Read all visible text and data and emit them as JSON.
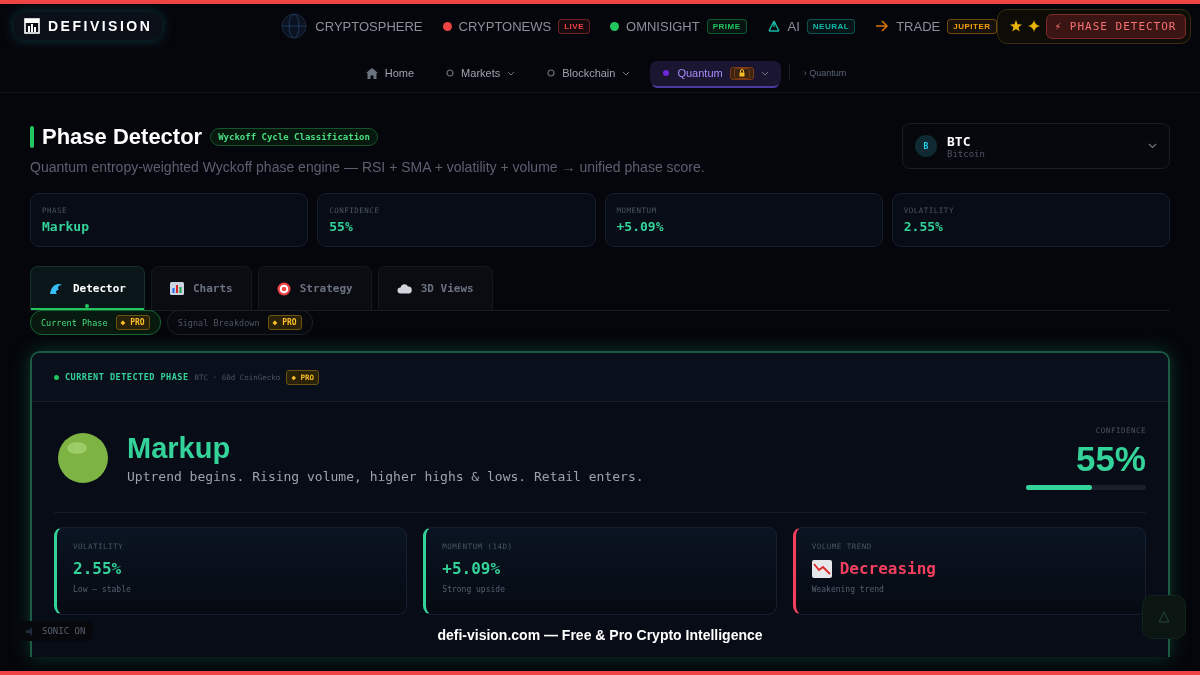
{
  "brand": {
    "name": "DEFIVISION"
  },
  "top_nav": [
    {
      "label": "CRYPTOSPHERE",
      "kind": "globe"
    },
    {
      "label": "CRYPTONEWS",
      "kind": "dot",
      "badge": "LIVE",
      "color": "#ef4444"
    },
    {
      "label": "OMNISIGHT",
      "kind": "dot",
      "badge": "PRIME",
      "color": "#22c55e"
    },
    {
      "label": "AI",
      "kind": "nodes",
      "badge": "NEURAL",
      "color": "#14b8a6"
    },
    {
      "label": "TRADE",
      "kind": "arrow",
      "badge": "JUPITER",
      "color": "#f59e0b"
    }
  ],
  "upgrade": {
    "label": "⚡ PHASE DETECTOR"
  },
  "sub_nav": [
    {
      "label": "Home",
      "kind": "home",
      "selected": false,
      "dropdown": false,
      "locked": false
    },
    {
      "label": "Markets",
      "kind": "ring",
      "selected": false,
      "dropdown": true,
      "locked": false
    },
    {
      "label": "Blockchain",
      "kind": "ring",
      "selected": false,
      "dropdown": true,
      "locked": false
    },
    {
      "label": "Quantum",
      "kind": "dot",
      "selected": true,
      "dropdown": true,
      "locked": true
    }
  ],
  "breadcrumb": "› Quantum",
  "header": {
    "title": "Phase Detector",
    "tag": "Wyckoff Cycle Classification",
    "subtitle": "Quantum entropy-weighted Wyckoff phase engine — RSI + SMA + volatility + volume → unified phase score."
  },
  "asset_select": {
    "letter": "B",
    "symbol": "BTC",
    "name": "Bitcoin"
  },
  "stats": [
    {
      "label": "PHASE",
      "value": "Markup"
    },
    {
      "label": "CONFIDENCE",
      "value": "55%"
    },
    {
      "label": "MOMENTUM",
      "value": "+5.09%"
    },
    {
      "label": "VOLATILITY",
      "value": "2.55%"
    }
  ],
  "tabs": [
    {
      "label": "Detector",
      "selected": true
    },
    {
      "label": "Charts",
      "selected": false
    },
    {
      "label": "Strategy",
      "selected": false
    },
    {
      "label": "3D Views",
      "selected": false
    }
  ],
  "subtabs": [
    {
      "label": "Current Phase",
      "badge": "◆ PRO",
      "selected": true
    },
    {
      "label": "Signal Breakdown",
      "badge": "◆ PRO",
      "selected": false
    }
  ],
  "panel": {
    "heading": "CURRENT DETECTED PHASE",
    "source": "BTC · 60d CoinGecko",
    "badge": "◆ PRO",
    "phase": "Markup",
    "description": "Uptrend begins. Rising volume, higher highs & lows. Retail enters.",
    "confidence_label": "CONFIDENCE",
    "confidence": "55%",
    "level": 0.55,
    "metrics": [
      {
        "kind": "plain",
        "label": "VOLATILITY",
        "value": "2.55%",
        "note": "Low — stable",
        "color": "#34d399"
      },
      {
        "kind": "plain",
        "label": "MOMENTUM (14D)",
        "value": "+5.09%",
        "note": "Strong upside",
        "color": "#34d399"
      },
      {
        "kind": "trend",
        "label": "VOLUME TREND",
        "value": "Decreasing",
        "note": "Weakening trend",
        "color": "#f43f5e"
      }
    ]
  },
  "sound": {
    "label": "SONIC ON"
  },
  "footer": "defi-vision.com — Free & Pro Crypto Intelligence"
}
